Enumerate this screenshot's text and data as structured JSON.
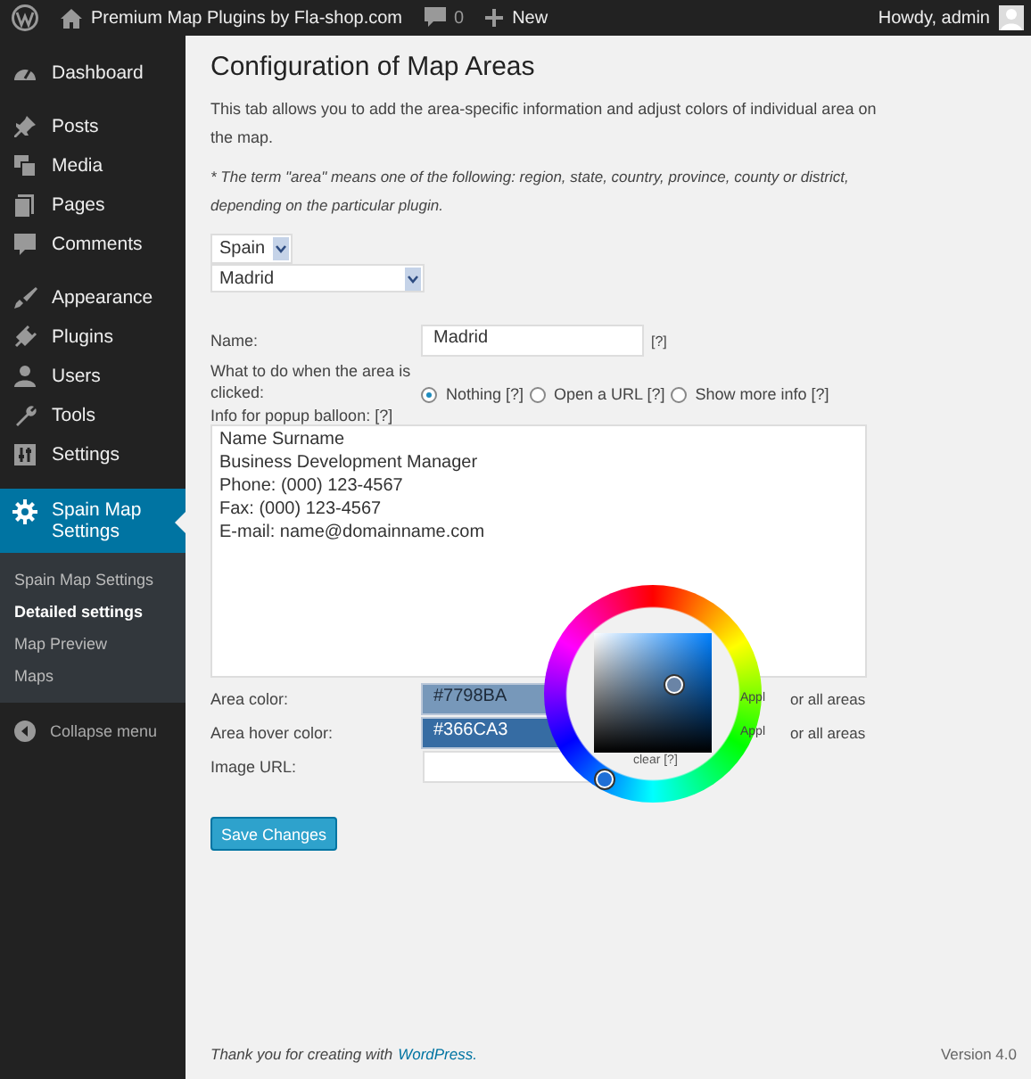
{
  "admin_bar": {
    "site": "Premium Map Plugins by Fla-shop.com",
    "comments": "0",
    "new": "New",
    "greeting": "Howdy, admin"
  },
  "sidebar": {
    "groups": [
      [
        {
          "label": "Dashboard",
          "selected": false
        }
      ],
      [
        {
          "label": "Posts",
          "selected": false
        },
        {
          "label": "Media",
          "selected": false
        },
        {
          "label": "Pages",
          "selected": false
        },
        {
          "label": "Comments",
          "selected": false
        }
      ],
      [
        {
          "label": "Appearance",
          "selected": false
        },
        {
          "label": "Plugins",
          "selected": false
        },
        {
          "label": "Users",
          "selected": false
        },
        {
          "label": "Tools",
          "selected": false
        },
        {
          "label": "Settings",
          "selected": false
        }
      ],
      [
        {
          "label": "Spain Map Settings",
          "selected": true,
          "children": [
            {
              "label": "Spain Map Settings",
              "selected": false
            },
            {
              "label": "Detailed settings",
              "selected": true
            },
            {
              "label": "Map Preview",
              "selected": false
            },
            {
              "label": "Maps",
              "selected": false
            }
          ]
        }
      ]
    ],
    "collapse": "Collapse menu"
  },
  "page": {
    "title": "Configuration of Map Areas",
    "intro": "This tab allows you to add the area-specific information and adjust colors of individual area on the map.",
    "note": "* The term \"area\" means one of the following: region, state, country, province, county or district, depending on the particular plugin.",
    "map_select": "Spain",
    "area_select": "Madrid",
    "name": {
      "label": "Name:",
      "value": "Madrid",
      "help": "[?]"
    },
    "click": {
      "label": "What to do when the area is clicked:",
      "options": [
        {
          "label": "Nothing [?]",
          "selected": true
        },
        {
          "label": "Open a URL [?]",
          "selected": false
        },
        {
          "label": "Show more info [?]",
          "selected": false
        }
      ]
    },
    "info": {
      "label": "Info for popup balloon: [?]",
      "value": "Name Surname\nBusiness Development Manager\nPhone: (000) 123-4567\nFax: (000) 123-4567\nE-mail: name@domainname.com"
    },
    "colors": [
      {
        "label": "Area color:",
        "value": "#7798BA",
        "color": "#7798ba",
        "apply_before": "Appl",
        "apply_after": "or all areas"
      },
      {
        "label": "Area hover color:",
        "value": "#366CA3",
        "color": "#366ca3",
        "apply_before": "Appl",
        "apply_after": "or all areas"
      }
    ],
    "image": {
      "label": "Image URL:"
    },
    "picker": {
      "clear": "clear [?]"
    },
    "save": "Save Changes"
  },
  "footer": {
    "thanks": "Thank you for creating with",
    "link": "WordPress.",
    "version": "Version 4.0"
  }
}
